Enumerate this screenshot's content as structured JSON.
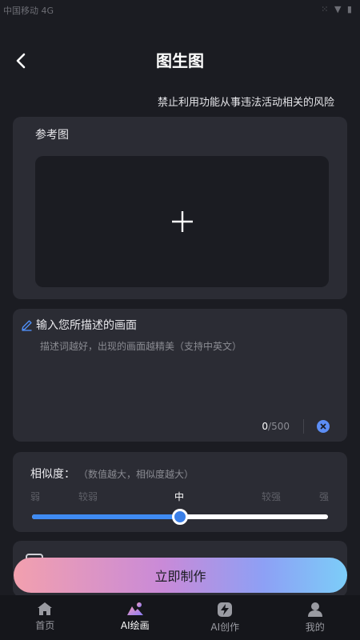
{
  "status_bar": {
    "left": "中国移动 4G",
    "right": "⁙ ▼ ▮"
  },
  "header": {
    "title": "图生图"
  },
  "warning": "禁止利用功能从事违法活动相关的风险",
  "reference": {
    "label": "参考图"
  },
  "description": {
    "title": "输入您所描述的画面",
    "value": "",
    "placeholder": "描述词越好，出现的画面越精美（支持中英文）",
    "count": "0",
    "max": "/500"
  },
  "similarity": {
    "title": "相似度：",
    "hint": "（数值越大，相似度越大）",
    "levels": [
      "弱",
      "较弱",
      "中",
      "较强",
      "强"
    ],
    "selected_index": 2,
    "value_fraction": 0.5
  },
  "create_button": "立即制作",
  "tabs": [
    {
      "label": "首页",
      "icon": "home-icon"
    },
    {
      "label": "AI绘画",
      "icon": "ai-painting-icon"
    },
    {
      "label": "AI创作",
      "icon": "lightning-icon"
    },
    {
      "label": "我的",
      "icon": "user-icon"
    }
  ],
  "active_tab": 1,
  "colors": {
    "accent": "#3f8bf2",
    "background": "#1b1c22",
    "card": "#2b2c34"
  }
}
